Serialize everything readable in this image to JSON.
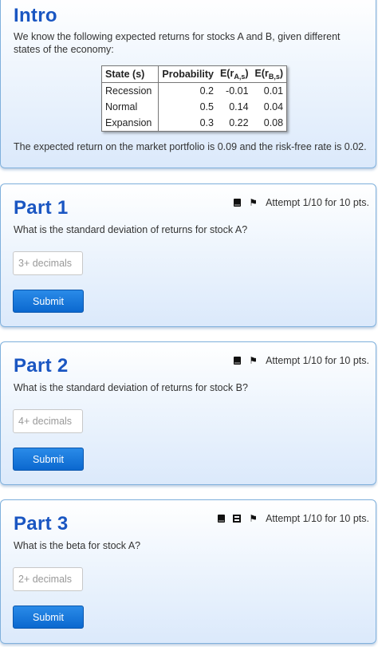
{
  "intro": {
    "title": "Intro",
    "text": "We know the following expected returns for stocks A and B, given different states of the economy:",
    "table": {
      "headers": {
        "state": "State (s)",
        "probability": "Probability",
        "erA": "E(r",
        "erA_sub": "A,s",
        "erB": "E(r",
        "erB_sub": "B,s",
        "close": ")"
      },
      "rows": [
        {
          "state": "Recession",
          "probability": "0.2",
          "erA": "-0.01",
          "erB": "0.01"
        },
        {
          "state": "Normal",
          "probability": "0.5",
          "erA": "0.14",
          "erB": "0.04"
        },
        {
          "state": "Expansion",
          "probability": "0.3",
          "erA": "0.22",
          "erB": "0.08"
        }
      ]
    },
    "footer": "The expected return on the market portfolio is 0.09 and the risk-free rate is 0.02."
  },
  "parts": [
    {
      "title": "Part 1",
      "attempt": "Attempt 1/10 for 10 pts.",
      "question": "What is the standard deviation of returns for stock A?",
      "placeholder": "3+ decimals",
      "submit": "Submit"
    },
    {
      "title": "Part 2",
      "attempt": "Attempt 1/10 for 10 pts.",
      "question": "What is the standard deviation of returns for stock B?",
      "placeholder": "4+ decimals",
      "submit": "Submit"
    },
    {
      "title": "Part 3",
      "attempt": "Attempt 1/10 for 10 pts.",
      "question": "What is the beta for stock A?",
      "placeholder": "2+ decimals",
      "submit": "Submit"
    }
  ],
  "icons": {
    "book": "book-icon",
    "film": "film-icon",
    "flag": "flag-icon"
  },
  "colors": {
    "title": "#1a56c2",
    "button": "#0b68cf",
    "card_border": "#7fb0dc"
  }
}
